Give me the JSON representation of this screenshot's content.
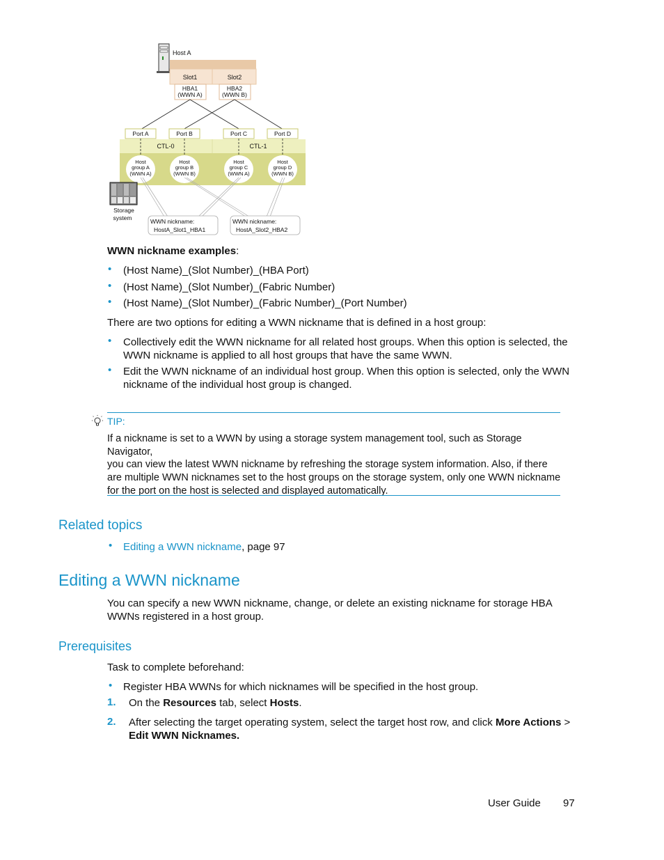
{
  "diagram": {
    "host_label": "Host A",
    "slots": [
      "Slot1",
      "Slot2"
    ],
    "hbas": [
      {
        "name": "HBA1",
        "wwn": "(WWN A)"
      },
      {
        "name": "HBA2",
        "wwn": "(WWN B)"
      }
    ],
    "ports": [
      "Port A",
      "Port B",
      "Port C",
      "Port D"
    ],
    "controllers": [
      "CTL-0",
      "CTL-1"
    ],
    "host_groups": [
      {
        "line1": "Host",
        "line2": "group A",
        "line3": "(WWN A)"
      },
      {
        "line1": "Host",
        "line2": "group B",
        "line3": "(WWN B)"
      },
      {
        "line1": "Host",
        "line2": "group C",
        "line3": "(WWN A)"
      },
      {
        "line1": "Host",
        "line2": "group D",
        "line3": "(WWN B)"
      }
    ],
    "storage_label_1": "Storage",
    "storage_label_2": "system",
    "callouts": [
      {
        "title": "WWN nickname:",
        "value": "HostA_Slot1_HBA1"
      },
      {
        "title": "WWN nickname:",
        "value": "HostA_Slot2_HBA2"
      }
    ],
    "colors": {
      "host_bar": "#e9c9a7",
      "slot_bg": "#f7e4d2",
      "ctl_bg": "#eef0bf",
      "hostgroup_bg": "#d7d98a",
      "port_border": "#c9c96c"
    }
  },
  "examples": {
    "heading": "WWN nickname examples",
    "heading_suffix": ":",
    "items": [
      "(Host Name)_(Slot Number)_(HBA Port)",
      "(Host Name)_(Slot Number)_(Fabric Number)",
      "(Host Name)_(Slot Number)_(Fabric Number)_(Port Number)"
    ]
  },
  "options": {
    "intro": "There are two options for editing a WWN nickname that is defined in a host group:",
    "items": [
      {
        "line1": "Collectively edit the WWN nickname for all related host groups. When this option is selected, the",
        "line2": "WWN nickname is applied to all host groups that have the same WWN."
      },
      {
        "line1": "Edit the WWN nickname of an individual host group. When this option is selected, only the WWN",
        "line2": "nickname of the individual host group is changed."
      }
    ]
  },
  "tip": {
    "label": "TIP:",
    "icon": "lightbulb-icon",
    "lines": [
      "If a nickname is set to a WWN by using a storage system management tool, such as Storage Navigator,",
      "you can view the latest WWN nickname by refreshing the storage system information. Also, if there",
      "are multiple WWN nicknames set to the host groups on the storage system, only one WWN nickname",
      "for the port on the host is selected and displayed automatically."
    ]
  },
  "related": {
    "heading": "Related topics",
    "link_text": "Editing a WWN nickname",
    "suffix": ", page 97"
  },
  "section": {
    "title": "Editing a WWN nickname",
    "desc_line1": "You can specify a new WWN nickname, change, or delete an existing nickname for storage HBA",
    "desc_line2": "WWNs registered in a host group."
  },
  "prereq": {
    "heading": "Prerequisites",
    "intro": "Task to complete beforehand:",
    "bullet": "Register HBA WWNs for which nicknames will be specified in the host group.",
    "steps": [
      {
        "num": "1.",
        "pre": "On the ",
        "b1": "Resources",
        "mid": " tab, select ",
        "b2": "Hosts",
        "post": "."
      },
      {
        "num": "2.",
        "pre": "After selecting the target operating system, select the target host row, and click ",
        "b1": "More Actions",
        "mid": " >",
        "b2": "Edit WWN Nicknames.",
        "post": ""
      }
    ]
  },
  "footer": {
    "label": "User Guide",
    "page": "97"
  }
}
